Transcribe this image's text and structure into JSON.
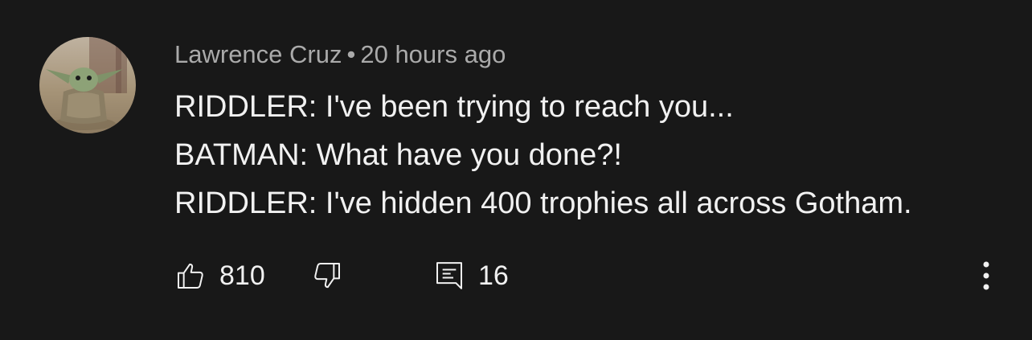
{
  "comment": {
    "author": "Lawrence Cruz",
    "separator": "•",
    "timestamp": "20 hours ago",
    "lines": [
      "RIDDLER: I've been trying to reach you...",
      "BATMAN: What have you done?!",
      "RIDDLER: I've hidden 400 trophies all across Gotham."
    ]
  },
  "actions": {
    "like_count": "810",
    "reply_count": "16",
    "icons": {
      "like": "thumbs-up-icon",
      "dislike": "thumbs-down-icon",
      "replies": "comment-icon",
      "more": "more-vertical-icon"
    }
  },
  "colors": {
    "background": "#181818",
    "primary_text": "#f1f1f1",
    "secondary_text": "#aaaaaa"
  }
}
